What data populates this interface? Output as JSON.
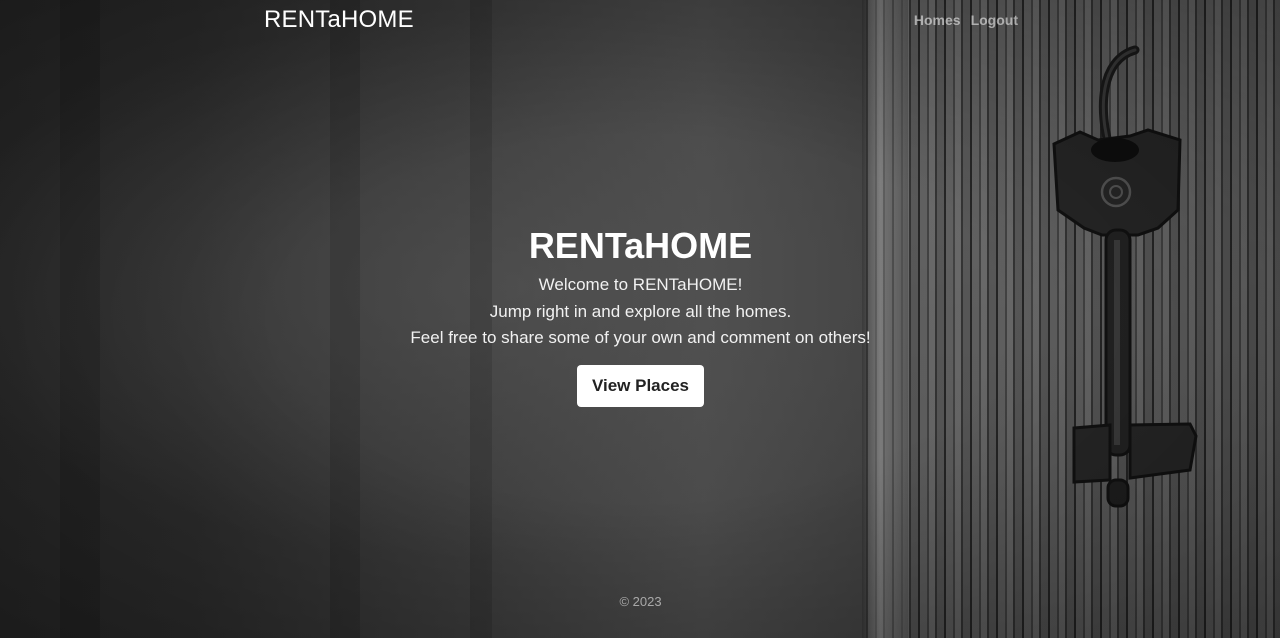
{
  "header": {
    "brand": "RENTaHOME",
    "nav": [
      {
        "label": "Homes"
      },
      {
        "label": "Logout"
      }
    ]
  },
  "hero": {
    "title": "RENTaHOME",
    "lines": [
      "Welcome to RENTaHOME!",
      "Jump right in and explore all the homes.",
      "Feel free to share some of your own and comment on others!"
    ],
    "button_label": "View Places"
  },
  "footer": {
    "copyright": "© 2023"
  },
  "colors": {
    "background": "#2f2f2f",
    "text": "#ffffff",
    "button_bg": "#ffffff",
    "button_text": "#222222"
  },
  "icons": [
    "key-image"
  ]
}
